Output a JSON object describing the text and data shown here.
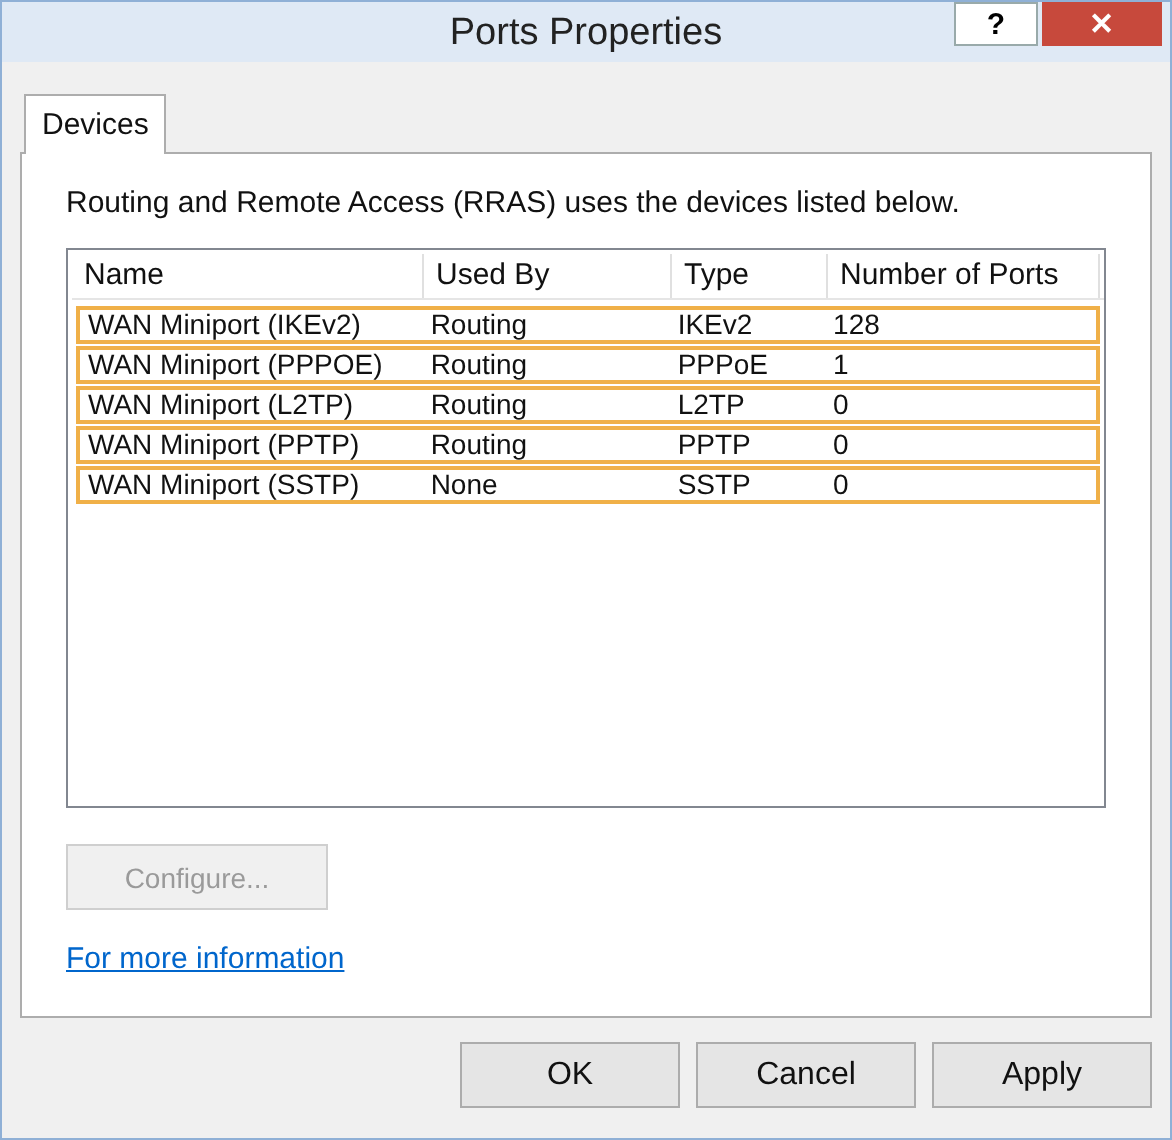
{
  "window": {
    "title": "Ports Properties",
    "help": "?",
    "close": "✕"
  },
  "tabs": [
    {
      "label": "Devices",
      "selected": true
    }
  ],
  "description": "Routing and Remote Access (RRAS) uses the devices listed below.",
  "table": {
    "columns": [
      "Name",
      "Used By",
      "Type",
      "Number of Ports"
    ],
    "rows": [
      {
        "cells": [
          "WAN Miniport (IKEv2)",
          "Routing",
          "IKEv2",
          "128"
        ],
        "highlighted": true
      },
      {
        "cells": [
          "WAN Miniport (PPPOE)",
          "Routing",
          "PPPoE",
          "1"
        ],
        "highlighted": true
      },
      {
        "cells": [
          "WAN Miniport (L2TP)",
          "Routing",
          "L2TP",
          "0"
        ],
        "highlighted": true
      },
      {
        "cells": [
          "WAN Miniport (PPTP)",
          "Routing",
          "PPTP",
          "0"
        ],
        "highlighted": true
      },
      {
        "cells": [
          "WAN Miniport (SSTP)",
          "None",
          "SSTP",
          "0"
        ],
        "highlighted": true
      }
    ]
  },
  "configure_button": {
    "label": "Configure...",
    "disabled": true
  },
  "link": "For more information",
  "buttons": [
    "OK",
    "Cancel",
    "Apply"
  ]
}
